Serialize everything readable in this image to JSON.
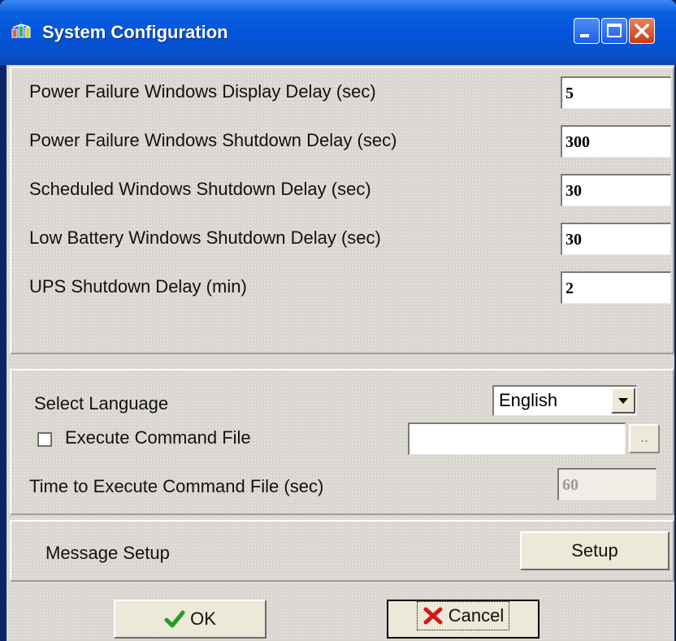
{
  "window": {
    "title": "System Configuration"
  },
  "delays": [
    {
      "label": "Power Failure Windows Display Delay (sec)",
      "value": "5"
    },
    {
      "label": "Power Failure Windows Shutdown Delay (sec)",
      "value": "300"
    },
    {
      "label": "Scheduled Windows Shutdown Delay (sec)",
      "value": "30"
    },
    {
      "label": "Low Battery Windows Shutdown Delay (sec)",
      "value": "30"
    },
    {
      "label": "UPS Shutdown Delay (min)",
      "value": "2"
    }
  ],
  "language": {
    "label": "Select Language",
    "selected": "English"
  },
  "command": {
    "checkbox_label": "Execute Command File",
    "checked": false,
    "file_value": "",
    "browse_label": "..",
    "time_label": "Time to Execute Command File (sec)",
    "time_value": "60"
  },
  "message": {
    "label": "Message Setup",
    "button_label": "Setup"
  },
  "buttons": {
    "ok_label": "OK",
    "cancel_label": "Cancel"
  },
  "colors": {
    "titlebar": "#0553d9",
    "ok_check": "#1f9e2a",
    "cancel_x": "#d11a1a",
    "close_button": "#c93a12"
  },
  "icons": [
    "app-icon",
    "minimize-icon",
    "maximize-icon",
    "close-icon",
    "dropdown-arrow-icon",
    "check-icon",
    "x-icon"
  ]
}
